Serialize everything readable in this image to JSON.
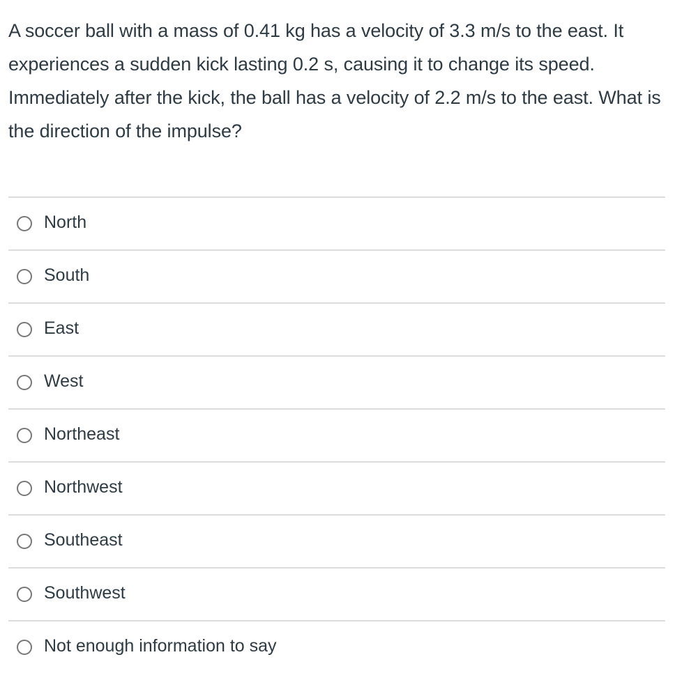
{
  "question": {
    "text": "A soccer ball with a mass of 0.41 kg has a velocity of 3.3 m/s to the east. It experiences a sudden kick lasting 0.2 s, causing it to change its speed. Immediately after the kick, the ball has a velocity of 2.2 m/s to the east. What is the direction of the impulse?"
  },
  "answers": [
    {
      "label": "North",
      "selected": false
    },
    {
      "label": "South",
      "selected": false
    },
    {
      "label": "East",
      "selected": false
    },
    {
      "label": "West",
      "selected": false
    },
    {
      "label": "Northeast",
      "selected": false
    },
    {
      "label": "Northwest",
      "selected": false
    },
    {
      "label": "Southeast",
      "selected": false
    },
    {
      "label": "Southwest",
      "selected": false
    },
    {
      "label": "Not enough information to say",
      "selected": false
    }
  ],
  "colors": {
    "text": "#2d3b45",
    "divider": "#dddddd",
    "radio_border": "#777777"
  }
}
